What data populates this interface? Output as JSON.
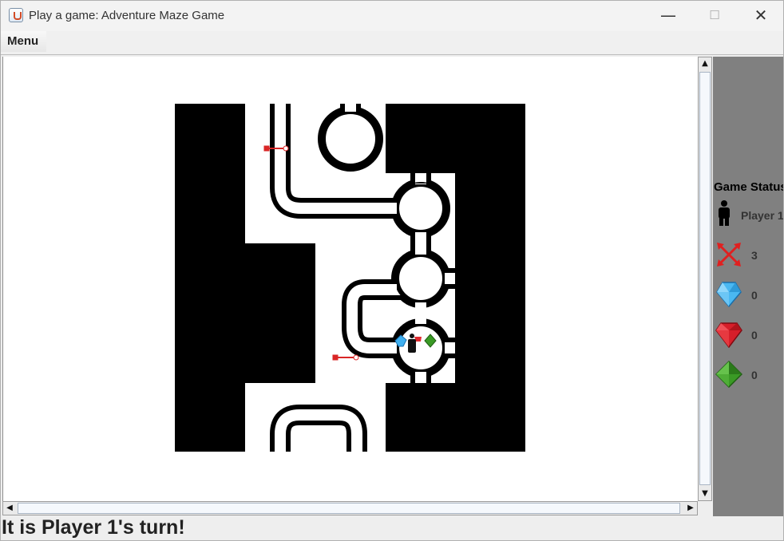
{
  "window": {
    "title": "Play a game: Adventure Maze Game",
    "minimize_glyph": "—",
    "maximize_glyph": "☐",
    "close_glyph": "✕"
  },
  "menubar": {
    "menu_label": "Menu"
  },
  "scrollbars": {
    "up_glyph": "▲",
    "down_glyph": "▼",
    "left_glyph": "◀",
    "right_glyph": "▶"
  },
  "game_status": {
    "heading": "Game Status",
    "player": {
      "name": "Player 1",
      "icon": "player-icon"
    },
    "arrows": {
      "count": "3",
      "icon": "crossed-arrows-icon",
      "color": "#e02020"
    },
    "blue_gems": {
      "count": "0",
      "icon": "blue-diamond-icon",
      "color": "#36a8ef"
    },
    "red_gems": {
      "count": "0",
      "icon": "red-ruby-icon",
      "color": "#d61f2a"
    },
    "green_gems": {
      "count": "0",
      "icon": "green-emerald-icon",
      "color": "#3a9a25"
    }
  },
  "maze": {
    "wall_color": "#000000",
    "floor_color": "#ffffff",
    "visible_items": [
      "arrow",
      "arrow",
      "player",
      "blue-gem",
      "red-gem",
      "green-gem"
    ]
  },
  "status_bar": {
    "message": "It is Player 1's turn!"
  }
}
